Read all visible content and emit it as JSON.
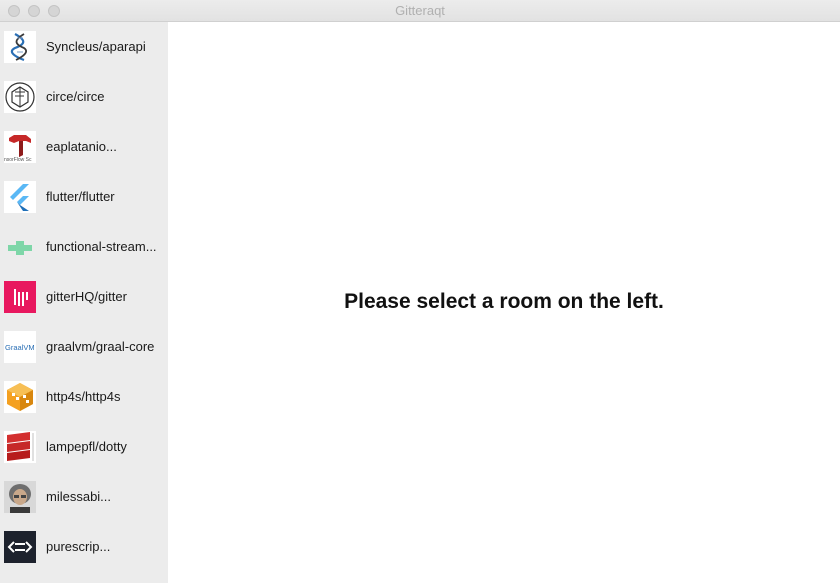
{
  "window": {
    "title": "Gitteraqt"
  },
  "sidebar": {
    "rooms": [
      {
        "name": "Syncleus/aparapi",
        "icon": "dna-helix-icon"
      },
      {
        "name": "circe/circe",
        "icon": "circe-hexagon-icon"
      },
      {
        "name": "eaplatanio...",
        "icon": "tensorflow-icon",
        "icon_text": "nsorFlow Sc"
      },
      {
        "name": "flutter/flutter",
        "icon": "flutter-logo-icon"
      },
      {
        "name": "functional-stream...",
        "icon": "green-pixel-icon"
      },
      {
        "name": "gitterHQ/gitter",
        "icon": "gitter-logo-icon"
      },
      {
        "name": "graalvm/graal-core",
        "icon": "graalvm-logo-icon",
        "icon_text": "GraalVM"
      },
      {
        "name": "http4s/http4s",
        "icon": "http4s-cube-icon"
      },
      {
        "name": "lampepfl/dotty",
        "icon": "dotty-logo-icon"
      },
      {
        "name": "milessabi...",
        "icon": "user-photo-icon"
      },
      {
        "name": "purescrip...",
        "icon": "purescript-logo-icon"
      }
    ]
  },
  "main": {
    "placeholder": "Please select a room on the left."
  },
  "colors": {
    "sidebar_bg": "#ececec",
    "titlebar_text": "#b0b0b0",
    "gitter_pink": "#e8185f",
    "flutter_blue": "#42a5f5",
    "http4s_orange": "#f4a020",
    "dotty_red": "#d32f2f"
  }
}
